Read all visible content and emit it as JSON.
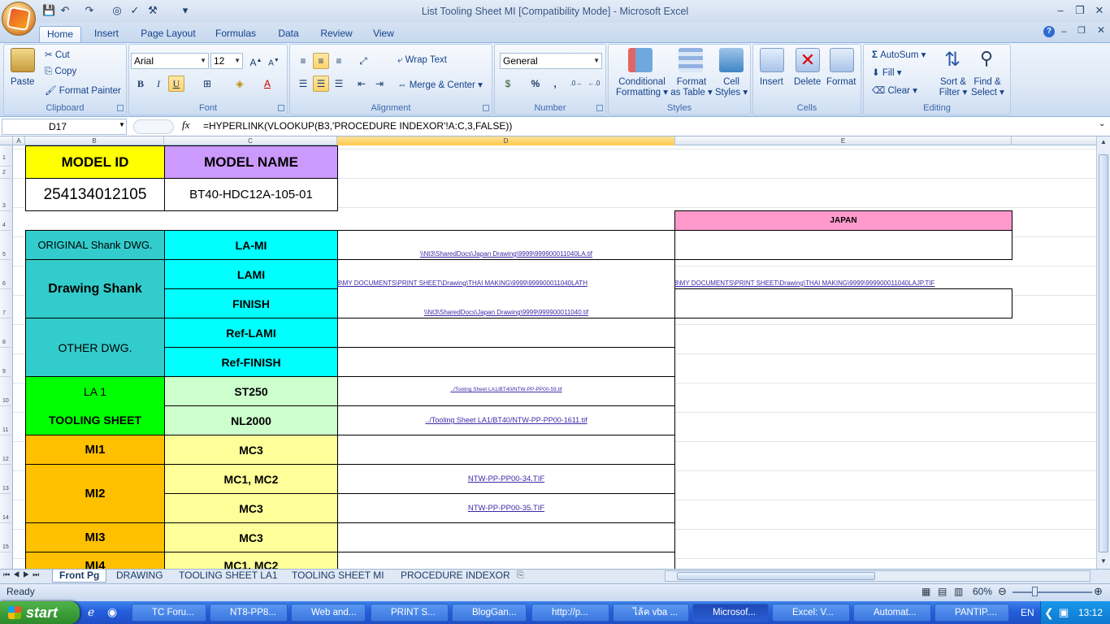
{
  "window": {
    "title": "List Tooling Sheet MI  [Compatibility Mode] - Microsoft Excel"
  },
  "ribbon_tabs": [
    "Home",
    "Insert",
    "Page Layout",
    "Formulas",
    "Data",
    "Review",
    "View"
  ],
  "clipboard": {
    "paste": "Paste",
    "cut": "Cut",
    "copy": "Copy",
    "format_painter": "Format Painter",
    "label": "Clipboard"
  },
  "font": {
    "name": "Arial",
    "size": "12",
    "label": "Font",
    "bold": "B",
    "italic": "I",
    "underline": "U"
  },
  "alignment": {
    "wrap": "Wrap Text",
    "merge": "Merge & Center",
    "label": "Alignment"
  },
  "number": {
    "format": "General",
    "label": "Number",
    "percent": "%",
    "comma": ","
  },
  "styles": {
    "conditional": "Conditional",
    "conditional2": "Formatting",
    "format_table": "Format",
    "format_table2": "as Table",
    "cell_styles": "Cell",
    "cell_styles2": "Styles",
    "label": "Styles"
  },
  "cells": {
    "insert": "Insert",
    "delete": "Delete",
    "format": "Format",
    "label": "Cells"
  },
  "editing": {
    "autosum": "AutoSum",
    "fill": "Fill",
    "clear": "Clear",
    "sort": "Sort &",
    "sort2": "Filter",
    "find": "Find &",
    "find2": "Select",
    "label": "Editing"
  },
  "formula_bar": {
    "name_box": "D17",
    "fx": "fx",
    "formula": "=HYPERLINK(VLOOKUP(B3,'PROCEDURE INDEXOR'!A:C,3,FALSE))"
  },
  "columns": [
    "A",
    "B",
    "C",
    "D",
    "E"
  ],
  "rows": [
    "1",
    "2",
    "3",
    "4",
    "5",
    "6",
    "7",
    "8",
    "9",
    "10",
    "11",
    "12",
    "13",
    "14",
    "15"
  ],
  "sheet": {
    "model_id_hdr": "MODEL  ID",
    "model_name_hdr": "MODEL NAME",
    "model_id": "254134012105",
    "model_name": "BT40-HDC12A-105-01",
    "japan": "JAPAN",
    "original": "ORIGINAL Shank DWG.",
    "la_mi": "LA-MI",
    "drawing_shank": "Drawing Shank",
    "lami": "LAMI",
    "finish": "FINISH",
    "other_dwg": "OTHER DWG.",
    "ref_lami": "Ref-LAMI",
    "ref_finish": "Ref-FINISH",
    "la1": "LA 1",
    "tooling_sheet": "TOOLING  SHEET",
    "st250": "ST250",
    "nl2000": "NL2000",
    "mi1": "MI1",
    "mc3_a": "MC3",
    "mi2": "MI2",
    "mc12_a": "MC1, MC2",
    "mc3_b": "MC3",
    "mi3": "MI3",
    "mc3_c": "MC3",
    "mi4": "MI4",
    "mc12_b": "MC1, MC2",
    "link_r5": "\\\\Nt3\\SharedDocs\\Japan Drawing\\9999\\999900011040LA.tif",
    "link_r6d": "8\\MY DOCUMENTS\\PRINT SHEET\\Drawing\\THAI MAKING\\9999\\999900011040LATH",
    "link_r6e": "8\\MY DOCUMENTS\\PRINT SHEET\\Drawing\\THAI MAKING\\9999\\999900011040LAJP.TIF",
    "link_r7": "\\\\Nt3\\SharedDocs\\Japan Drawing\\9999\\999900011040.tif",
    "link_r10": "../Tooling Sheet LA1/BT40/NTW-PP-PP00-59.tif",
    "link_r11": "../Tooling Sheet LA1/BT40/NTW-PP-PP00-1611.tif",
    "link_r13": "NTW-PP-PP00-34.TIF",
    "link_r14": "NTW-PP-PP00-35.TIF"
  },
  "sheet_tabs": [
    "Front Pg",
    "DRAWING",
    "TOOLING SHEET LA1",
    "TOOLING SHEET MI",
    "PROCEDURE INDEXOR"
  ],
  "status": {
    "ready": "Ready",
    "zoom": "60%"
  },
  "taskbar": {
    "start": "start",
    "items": [
      "TC Foru...",
      "NT8-PP8...",
      "Web and...",
      "PRINT S...",
      "BlogGan...",
      "http://p...",
      "ไล้ค vba ...",
      "Microsof...",
      "Excel: V...",
      "Automat...",
      "PANTIP...."
    ],
    "lang": "EN",
    "clock": "13:12"
  },
  "colors": {
    "yellow": "#ffff00",
    "lavender": "#cc99ff",
    "teal": "#33cccc",
    "cyan": "#00ffff",
    "green": "#00ff00",
    "lightgreen": "#ccffcc",
    "orange": "#ffc000",
    "lightyellow": "#ffff99",
    "pink": "#ff99cc"
  }
}
